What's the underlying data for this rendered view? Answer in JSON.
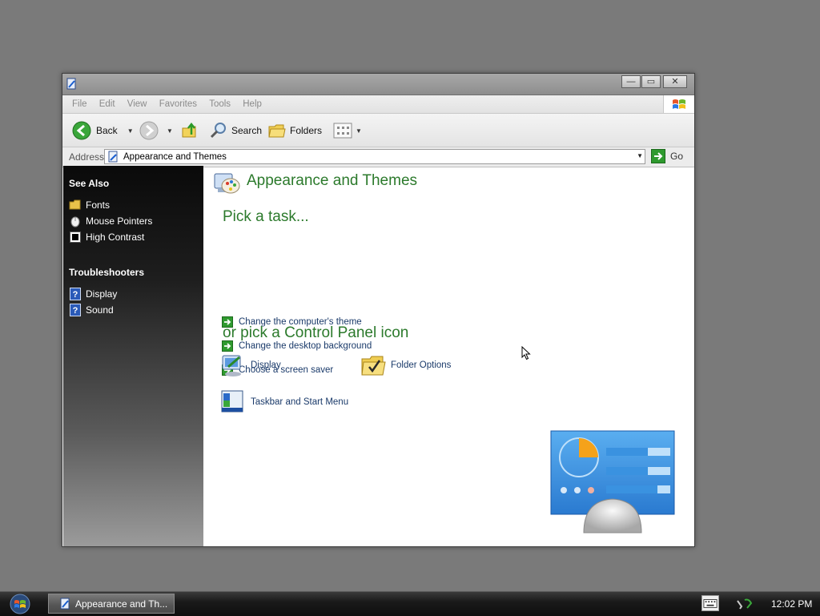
{
  "window": {
    "title": "",
    "controls": {
      "minimize": "—",
      "maximize": "▭",
      "close": "✕"
    }
  },
  "menubar": {
    "items": [
      "File",
      "Edit",
      "View",
      "Favorites",
      "Tools",
      "Help"
    ]
  },
  "toolbar": {
    "back_label": "Back",
    "search_label": "Search",
    "folders_label": "Folders"
  },
  "address": {
    "label": "Address",
    "value": "Appearance and Themes",
    "go_label": "Go"
  },
  "sidebar": {
    "see_also": {
      "heading": "See Also",
      "items": [
        {
          "label": "Fonts",
          "icon": "folder-icon"
        },
        {
          "label": "Mouse Pointers",
          "icon": "mouse-icon"
        },
        {
          "label": "High Contrast",
          "icon": "contrast-icon"
        }
      ]
    },
    "troubleshooters": {
      "heading": "Troubleshooters",
      "items": [
        {
          "label": "Display",
          "icon": "help-icon"
        },
        {
          "label": "Sound",
          "icon": "help-icon"
        }
      ]
    }
  },
  "main": {
    "title": "Appearance and Themes",
    "pick_task_heading": "Pick a task...",
    "tasks": [
      "Change the computer's theme",
      "Change the desktop background",
      "Choose a screen saver"
    ],
    "pick_icon_heading": "or pick a Control Panel icon",
    "icons": [
      {
        "label": "Display",
        "icon": "display-icon"
      },
      {
        "label": "Folder Options",
        "icon": "folder-options-icon"
      },
      {
        "label": "Taskbar and Start Menu",
        "icon": "taskbar-icon"
      }
    ]
  },
  "taskbar": {
    "task_label": "Appearance and Th...",
    "clock": "12:02 PM"
  },
  "colors": {
    "heading_green": "#2c7a2c",
    "link_blue": "#1a3a6a",
    "desktop": "#7a7a7a"
  }
}
